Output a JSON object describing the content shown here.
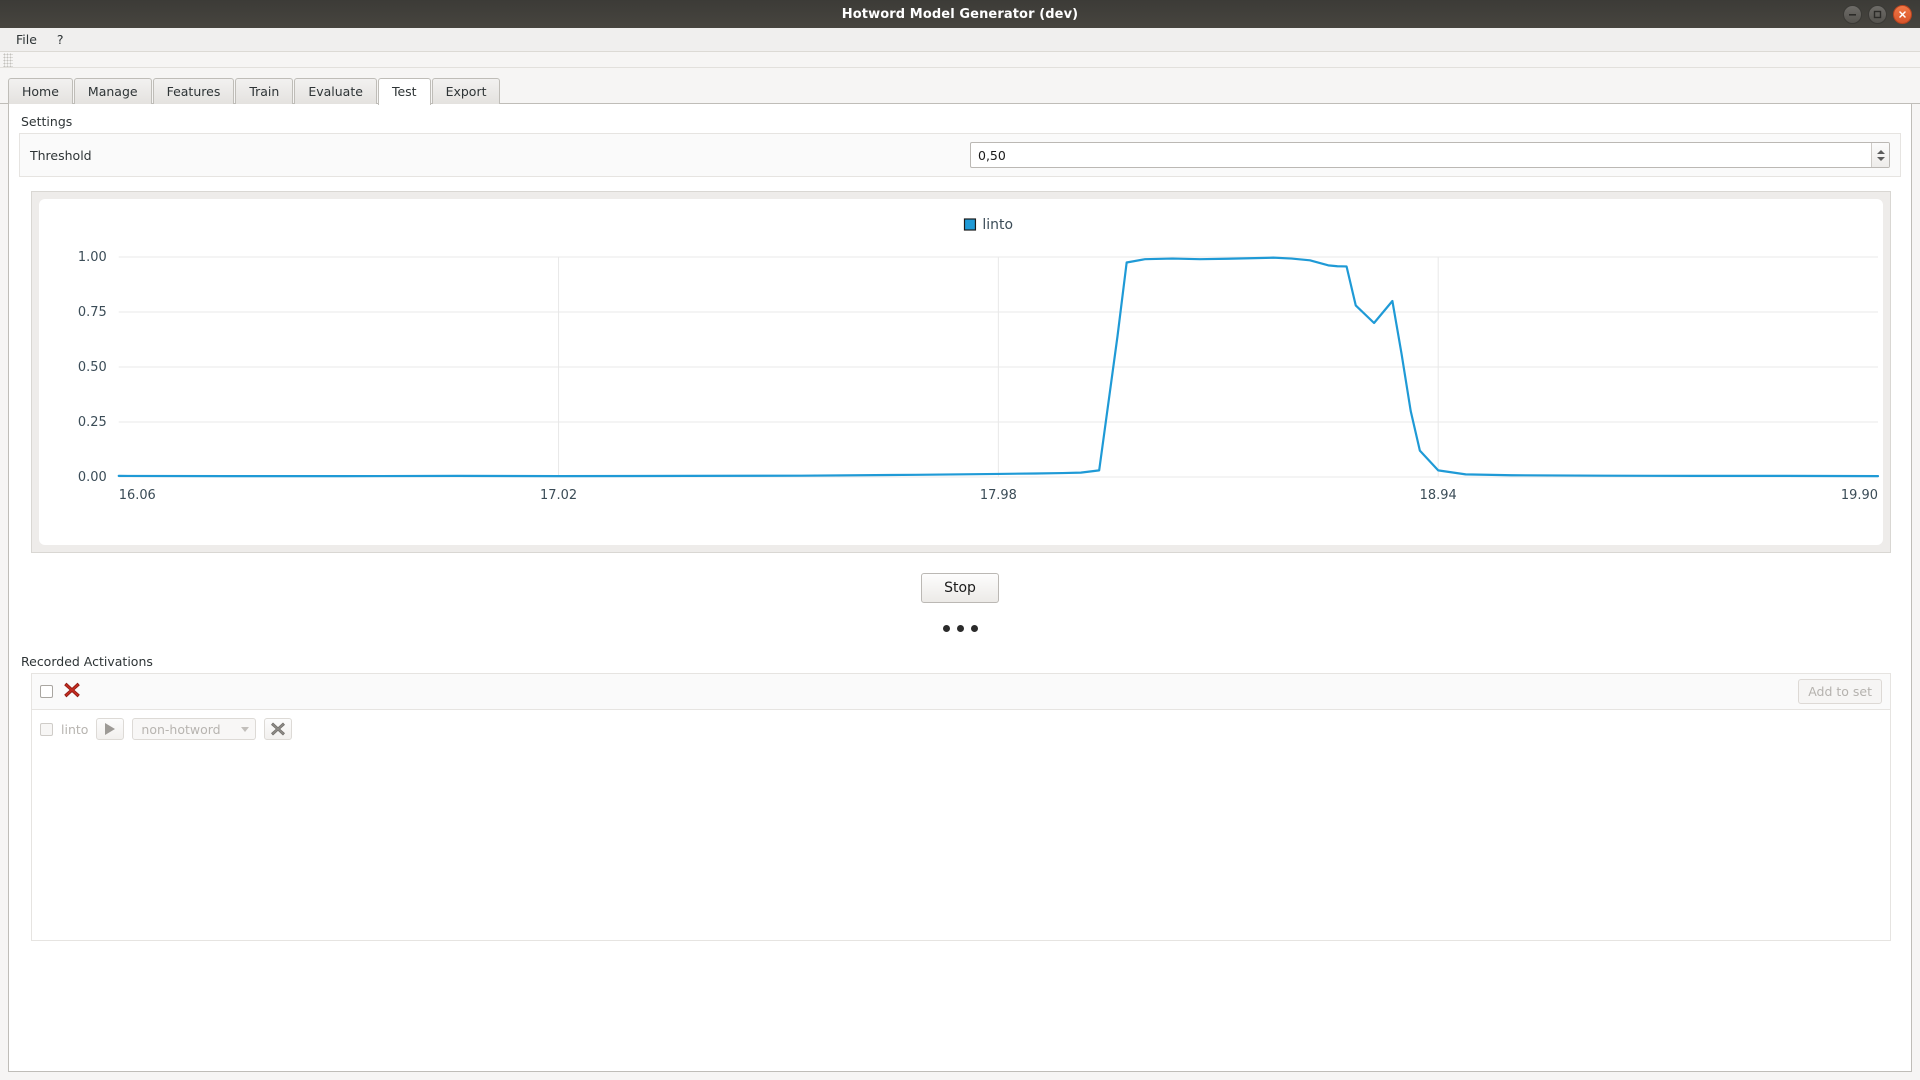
{
  "window": {
    "title": "Hotword Model Generator (dev)",
    "controls": [
      {
        "name": "minimize-button",
        "glyph": "minimize-icon"
      },
      {
        "name": "maximize-button",
        "glyph": "maximize-icon"
      },
      {
        "name": "close-button",
        "glyph": "close-icon"
      }
    ]
  },
  "menubar": {
    "items": [
      "File",
      "?"
    ]
  },
  "tabs": {
    "items": [
      "Home",
      "Manage",
      "Features",
      "Train",
      "Evaluate",
      "Test",
      "Export"
    ],
    "active": "Test"
  },
  "settings": {
    "group_label": "Settings",
    "threshold_label": "Threshold",
    "threshold_value": "0,50"
  },
  "chart_data": {
    "type": "line",
    "title": "",
    "xlabel": "",
    "ylabel": "",
    "legend": [
      "linto"
    ],
    "legend_position": "top-center",
    "series_color": "#1f9ad6",
    "grid": true,
    "xlim": [
      16.06,
      19.9
    ],
    "ylim": [
      0.0,
      1.0
    ],
    "xticks": [
      "16.06",
      "17.02",
      "17.98",
      "18.94",
      "19.90"
    ],
    "yticks": [
      "0.00",
      "0.25",
      "0.50",
      "0.75",
      "1.00"
    ],
    "series": [
      {
        "name": "linto",
        "x": [
          16.06,
          16.3,
          16.55,
          16.8,
          17.02,
          17.3,
          17.55,
          17.8,
          17.98,
          18.06,
          18.12,
          18.16,
          18.2,
          18.24,
          18.26,
          18.3,
          18.36,
          18.42,
          18.48,
          18.54,
          18.58,
          18.62,
          18.66,
          18.7,
          18.72,
          18.74,
          18.76,
          18.8,
          18.84,
          18.86,
          18.88,
          18.9,
          18.94,
          19.0,
          19.1,
          19.3,
          19.5,
          19.7,
          19.9
        ],
        "y": [
          0.005,
          0.004,
          0.004,
          0.005,
          0.004,
          0.005,
          0.006,
          0.01,
          0.014,
          0.016,
          0.018,
          0.02,
          0.03,
          0.64,
          0.975,
          0.99,
          0.993,
          0.99,
          0.992,
          0.995,
          0.997,
          0.993,
          0.985,
          0.962,
          0.958,
          0.957,
          0.78,
          0.7,
          0.8,
          0.56,
          0.3,
          0.12,
          0.03,
          0.012,
          0.008,
          0.006,
          0.005,
          0.005,
          0.004
        ]
      }
    ]
  },
  "actions": {
    "stop_label": "Stop",
    "progress_dots": 3
  },
  "recorded": {
    "label": "Recorded Activations",
    "toolbar": {
      "select_all_checked": false,
      "delete_icon": "red-cross-icon",
      "add_to_set_label": "Add to set",
      "add_to_set_enabled": false
    },
    "rows": [
      {
        "checked": false,
        "name": "linto",
        "play_icon": "play-icon",
        "category": "non-hotword",
        "delete_icon": "gray-cross-icon",
        "enabled": false
      }
    ]
  }
}
